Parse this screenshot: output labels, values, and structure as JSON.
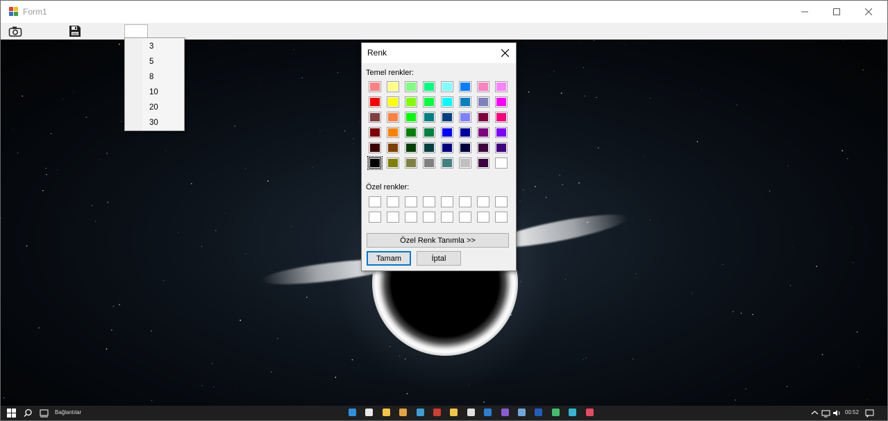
{
  "window": {
    "title": "Form1"
  },
  "toolbar": {
    "camera_icon": "camera-icon",
    "save_icon": "floppy-disk-icon"
  },
  "dropdown": {
    "items": [
      {
        "label": "3"
      },
      {
        "label": "5"
      },
      {
        "label": "8"
      },
      {
        "label": "10"
      },
      {
        "label": "20"
      },
      {
        "label": "30"
      }
    ]
  },
  "color_dialog": {
    "title": "Renk",
    "basic_label": "Temel renkler:",
    "custom_label": "Özel renkler:",
    "define_custom_button": "Özel Renk Tanımla >>",
    "ok_button": "Tamam",
    "cancel_button": "İptal",
    "basic_colors": [
      [
        "#ff8080",
        "#ffff80",
        "#80ff80",
        "#00ff80",
        "#80ffff",
        "#0080ff",
        "#ff80c0",
        "#ff80ff"
      ],
      [
        "#ff0000",
        "#ffff00",
        "#80ff00",
        "#00ff40",
        "#00ffff",
        "#0080c0",
        "#8080c0",
        "#ff00ff"
      ],
      [
        "#804040",
        "#ff8040",
        "#00ff00",
        "#008080",
        "#004080",
        "#8080ff",
        "#800040",
        "#ff0080"
      ],
      [
        "#800000",
        "#ff8000",
        "#008000",
        "#008040",
        "#0000ff",
        "#0000a0",
        "#800080",
        "#8000ff"
      ],
      [
        "#400000",
        "#804000",
        "#004000",
        "#004040",
        "#000080",
        "#000040",
        "#400040",
        "#400080"
      ],
      [
        "#000000",
        "#808000",
        "#808040",
        "#808080",
        "#408080",
        "#c0c0c0",
        "#400040",
        "#ffffff"
      ]
    ],
    "selected_color": "#000000",
    "custom_colors": [
      "#ffffff",
      "#ffffff",
      "#ffffff",
      "#ffffff",
      "#ffffff",
      "#ffffff",
      "#ffffff",
      "#ffffff",
      "#ffffff",
      "#ffffff",
      "#ffffff",
      "#ffffff",
      "#ffffff",
      "#ffffff",
      "#ffffff",
      "#ffffff"
    ]
  },
  "taskbar": {
    "search_label": "Bağlantılar",
    "time": "00:52"
  }
}
